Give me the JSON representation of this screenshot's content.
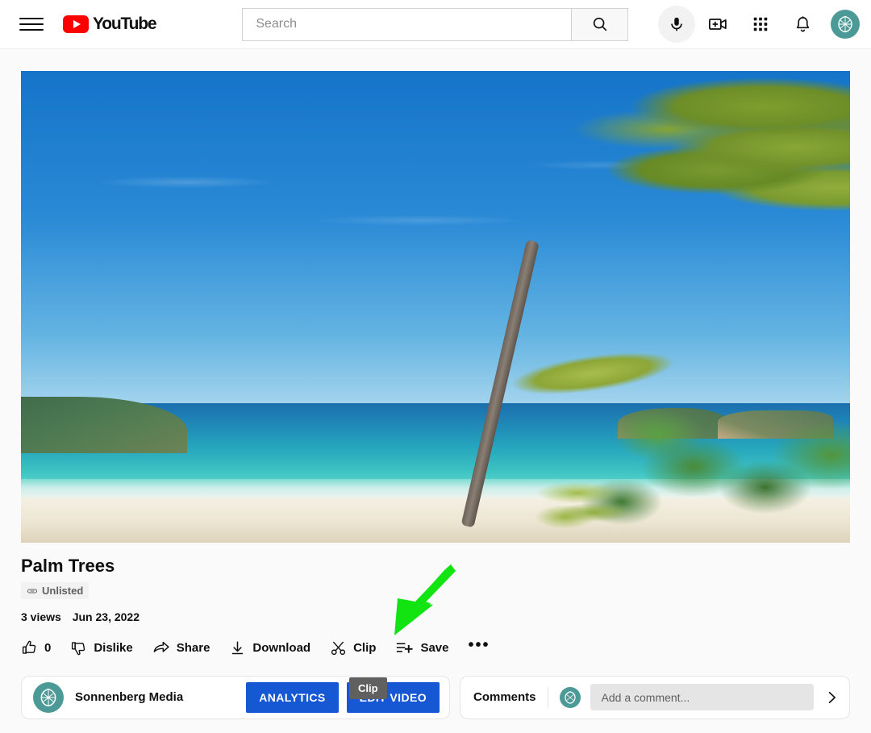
{
  "header": {
    "menu_label": "Guide menu",
    "logo_text": "YouTube",
    "search": {
      "placeholder": "Search",
      "value": ""
    },
    "icons": {
      "search": "search-icon",
      "mic": "microphone-icon",
      "create": "create-video-icon",
      "apps": "apps-grid-icon",
      "notifications": "notifications-bell-icon",
      "avatar": "account-avatar"
    }
  },
  "video": {
    "title": "Palm Trees",
    "privacy_badge": "Unlisted",
    "privacy_icon": "link-icon",
    "views": "3 views",
    "date": "Jun 23, 2022",
    "scene": "tropical beach with leaning palm tree, turquoise ocean and blue sky"
  },
  "actions": [
    {
      "name": "like",
      "label": "0",
      "icon": "thumbs-up-icon"
    },
    {
      "name": "dislike",
      "label": "Dislike",
      "icon": "thumbs-down-icon"
    },
    {
      "name": "share",
      "label": "Share",
      "icon": "share-arrow-icon"
    },
    {
      "name": "download",
      "label": "Download",
      "icon": "download-icon"
    },
    {
      "name": "clip",
      "label": "Clip",
      "icon": "scissors-icon"
    },
    {
      "name": "save",
      "label": "Save",
      "icon": "save-playlist-icon"
    },
    {
      "name": "more",
      "label": "•••",
      "icon": "more-horizontal-icon"
    }
  ],
  "annotation": {
    "type": "arrow",
    "color": "#12e412",
    "points_to": "Clip"
  },
  "tooltip": {
    "text": "Clip"
  },
  "channel": {
    "name": "Sonnenberg Media",
    "analytics_label": "ANALYTICS",
    "edit_label": "EDIT VIDEO",
    "button_color": "#1657d3"
  },
  "comments": {
    "label": "Comments",
    "placeholder": "Add a comment...",
    "value": "",
    "expand_icon": "chevron-right-icon"
  }
}
